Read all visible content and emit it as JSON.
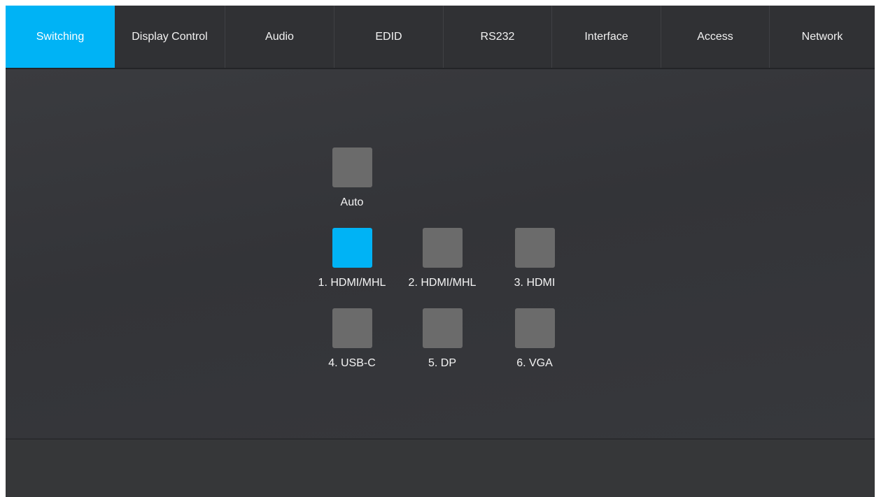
{
  "tabs": [
    {
      "label": "Switching",
      "active": true
    },
    {
      "label": "Display Control",
      "active": false
    },
    {
      "label": "Audio",
      "active": false
    },
    {
      "label": "EDID",
      "active": false
    },
    {
      "label": "RS232",
      "active": false
    },
    {
      "label": "Interface",
      "active": false
    },
    {
      "label": "Access",
      "active": false
    },
    {
      "label": "Network",
      "active": false
    }
  ],
  "switching": {
    "auto_label": "Auto",
    "selected_input": "1. HDMI/MHL",
    "inputs": [
      {
        "label": "1. HDMI/MHL",
        "selected": true
      },
      {
        "label": "2. HDMI/MHL",
        "selected": false
      },
      {
        "label": "3. HDMI",
        "selected": false
      },
      {
        "label": "4. USB-C",
        "selected": false
      },
      {
        "label": "5. DP",
        "selected": false
      },
      {
        "label": "6. VGA",
        "selected": false
      }
    ]
  },
  "colors": {
    "accent": "#00b3f5",
    "button_idle": "#6b6b6b",
    "background": "#35363a",
    "text": "#f4f4f4"
  }
}
